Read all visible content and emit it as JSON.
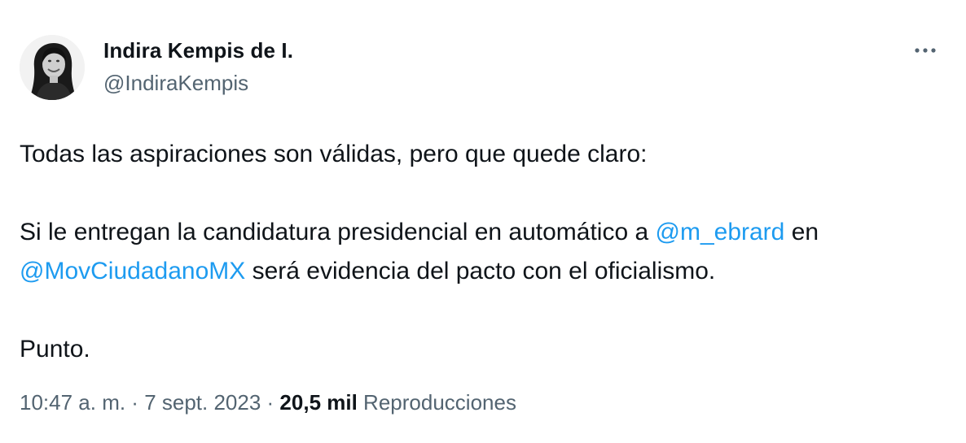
{
  "author": {
    "display_name": "Indira Kempis de I.",
    "handle": "@IndiraKempis"
  },
  "tweet": {
    "line1": "Todas las aspiraciones son válidas, pero que quede claro:",
    "line2_prefix": "Si le entregan la candidatura presidencial en automático a ",
    "mention1": "@m_ebrard",
    "line2_suffix": " en",
    "mention2": "@MovCiudadanoMX",
    "line3_suffix": " será evidencia del pacto con el oficialismo.",
    "line4": "Punto."
  },
  "meta": {
    "time": "10:47 a. m.",
    "separator1": " · ",
    "date": "7 sept. 2023",
    "separator2": " · ",
    "views_count": "20,5 mil",
    "views_label": " Reproducciones"
  },
  "colors": {
    "link": "#1d9bf0",
    "secondary": "#536471",
    "primary": "#0f1419"
  },
  "icons": {
    "more": "more-horizontal-icon"
  }
}
